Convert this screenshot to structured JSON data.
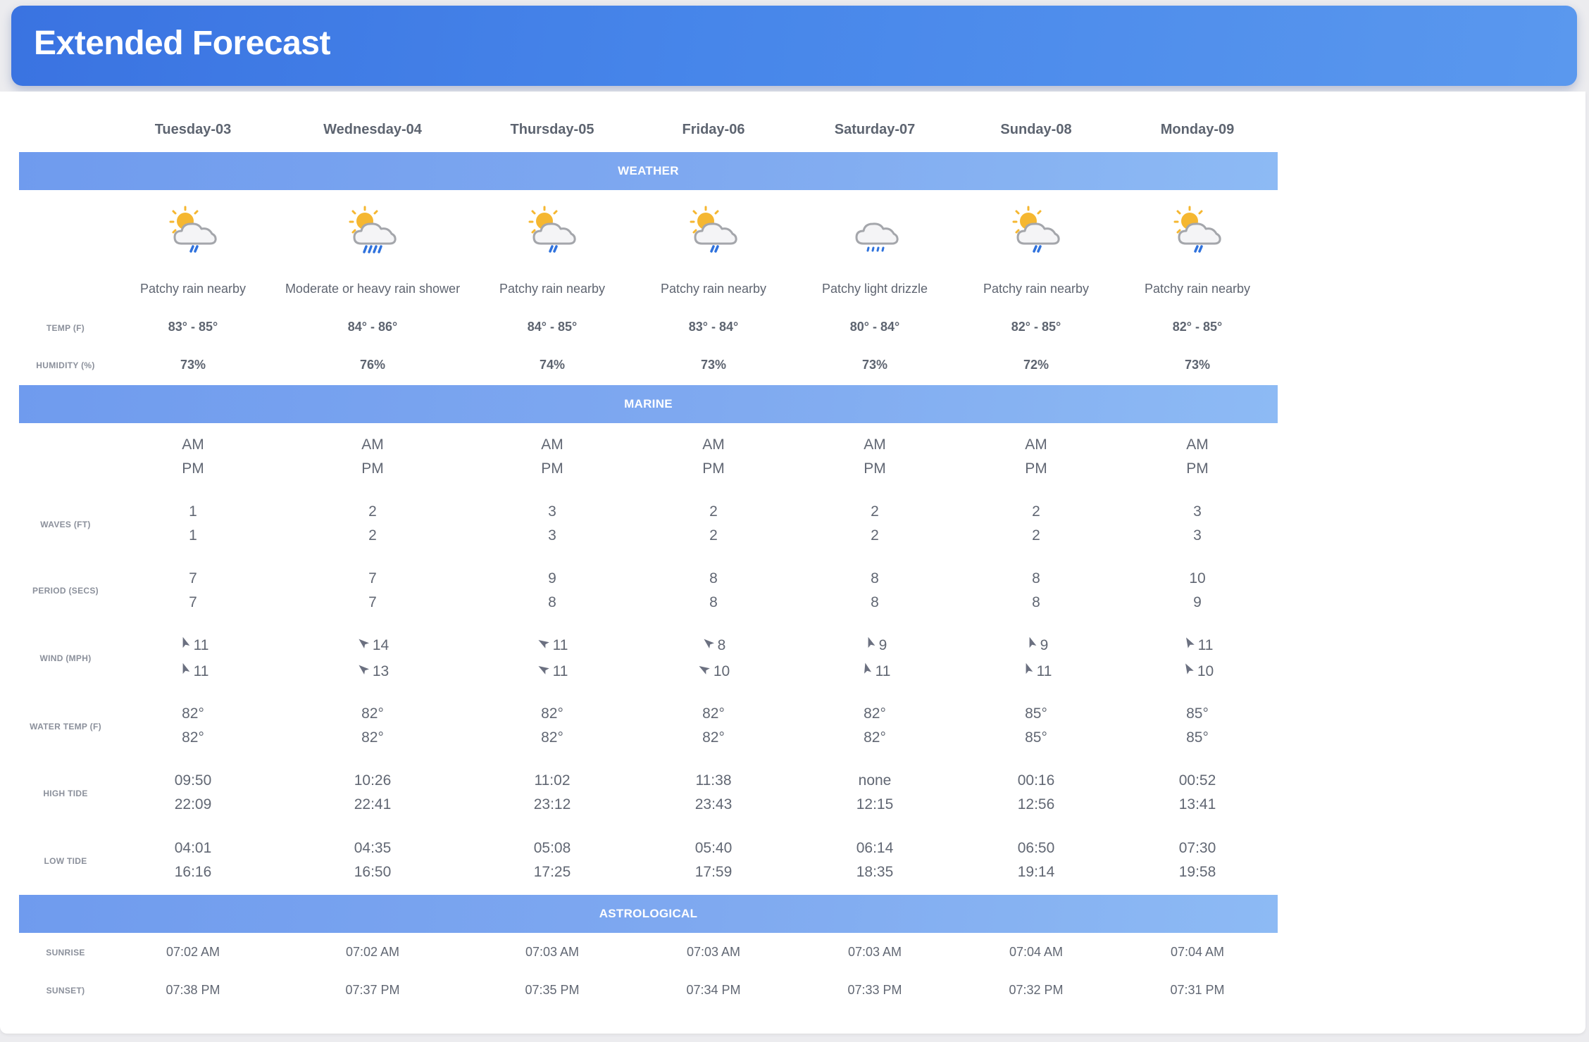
{
  "header": {
    "title": "Extended Forecast"
  },
  "days": [
    {
      "name": "Tuesday-03",
      "condition": "Patchy rain nearby",
      "icon": "patchy-rain-icon",
      "temp": "83° - 85°",
      "humidity": "73%",
      "am_label": "AM",
      "pm_label": "PM",
      "waves": {
        "am": "1",
        "pm": "1"
      },
      "period": {
        "am": "7",
        "pm": "7"
      },
      "wind": {
        "am": "11",
        "pm": "11",
        "am_dir": 160,
        "pm_dir": 160
      },
      "water_temp": {
        "am": "82°",
        "pm": "82°"
      },
      "high_tide": {
        "am": "09:50",
        "pm": "22:09"
      },
      "low_tide": {
        "am": "04:01",
        "pm": "16:16"
      },
      "sunrise": "07:02 AM",
      "sunset": "07:38 PM"
    },
    {
      "name": "Wednesday-04",
      "condition": "Moderate or heavy rain shower",
      "icon": "heavy-rain-shower-icon",
      "temp": "84° - 86°",
      "humidity": "76%",
      "am_label": "AM",
      "pm_label": "PM",
      "waves": {
        "am": "2",
        "pm": "2"
      },
      "period": {
        "am": "7",
        "pm": "7"
      },
      "wind": {
        "am": "14",
        "pm": "13",
        "am_dir": 130,
        "pm_dir": 130
      },
      "water_temp": {
        "am": "82°",
        "pm": "82°"
      },
      "high_tide": {
        "am": "10:26",
        "pm": "22:41"
      },
      "low_tide": {
        "am": "04:35",
        "pm": "16:50"
      },
      "sunrise": "07:02 AM",
      "sunset": "07:37 PM"
    },
    {
      "name": "Thursday-05",
      "condition": "Patchy rain nearby",
      "icon": "patchy-rain-icon",
      "temp": "84° - 85°",
      "humidity": "74%",
      "am_label": "AM",
      "pm_label": "PM",
      "waves": {
        "am": "3",
        "pm": "3"
      },
      "period": {
        "am": "9",
        "pm": "8"
      },
      "wind": {
        "am": "11",
        "pm": "11",
        "am_dir": 120,
        "pm_dir": 120
      },
      "water_temp": {
        "am": "82°",
        "pm": "82°"
      },
      "high_tide": {
        "am": "11:02",
        "pm": "23:12"
      },
      "low_tide": {
        "am": "05:08",
        "pm": "17:25"
      },
      "sunrise": "07:03 AM",
      "sunset": "07:35 PM"
    },
    {
      "name": "Friday-06",
      "condition": "Patchy rain nearby",
      "icon": "patchy-rain-icon",
      "temp": "83° - 84°",
      "humidity": "73%",
      "am_label": "AM",
      "pm_label": "PM",
      "waves": {
        "am": "2",
        "pm": "2"
      },
      "period": {
        "am": "8",
        "pm": "8"
      },
      "wind": {
        "am": "8",
        "pm": "10",
        "am_dir": 130,
        "pm_dir": 120
      },
      "water_temp": {
        "am": "82°",
        "pm": "82°"
      },
      "high_tide": {
        "am": "11:38",
        "pm": "23:43"
      },
      "low_tide": {
        "am": "05:40",
        "pm": "17:59"
      },
      "sunrise": "07:03 AM",
      "sunset": "07:34 PM"
    },
    {
      "name": "Saturday-07",
      "condition": "Patchy light drizzle",
      "icon": "light-drizzle-icon",
      "temp": "80° - 84°",
      "humidity": "73%",
      "am_label": "AM",
      "pm_label": "PM",
      "waves": {
        "am": "2",
        "pm": "2"
      },
      "period": {
        "am": "8",
        "pm": "8"
      },
      "wind": {
        "am": "9",
        "pm": "11",
        "am_dir": 160,
        "pm_dir": 165
      },
      "water_temp": {
        "am": "82°",
        "pm": "82°"
      },
      "high_tide": {
        "am": "none",
        "pm": "12:15"
      },
      "low_tide": {
        "am": "06:14",
        "pm": "18:35"
      },
      "sunrise": "07:03 AM",
      "sunset": "07:33 PM"
    },
    {
      "name": "Sunday-08",
      "condition": "Patchy rain nearby",
      "icon": "patchy-rain-icon",
      "temp": "82° - 85°",
      "humidity": "72%",
      "am_label": "AM",
      "pm_label": "PM",
      "waves": {
        "am": "2",
        "pm": "2"
      },
      "period": {
        "am": "8",
        "pm": "8"
      },
      "wind": {
        "am": "9",
        "pm": "11",
        "am_dir": 160,
        "pm_dir": 160
      },
      "water_temp": {
        "am": "85°",
        "pm": "85°"
      },
      "high_tide": {
        "am": "00:16",
        "pm": "12:56"
      },
      "low_tide": {
        "am": "06:50",
        "pm": "19:14"
      },
      "sunrise": "07:04 AM",
      "sunset": "07:32 PM"
    },
    {
      "name": "Monday-09",
      "condition": "Patchy rain nearby",
      "icon": "patchy-rain-icon",
      "temp": "82° - 85°",
      "humidity": "73%",
      "am_label": "AM",
      "pm_label": "PM",
      "waves": {
        "am": "3",
        "pm": "3"
      },
      "period": {
        "am": "10",
        "pm": "9"
      },
      "wind": {
        "am": "11",
        "pm": "10",
        "am_dir": 150,
        "pm_dir": 150
      },
      "water_temp": {
        "am": "85°",
        "pm": "85°"
      },
      "high_tide": {
        "am": "00:52",
        "pm": "13:41"
      },
      "low_tide": {
        "am": "07:30",
        "pm": "19:58"
      },
      "sunrise": "07:04 AM",
      "sunset": "07:31 PM"
    }
  ],
  "sections": {
    "weather": "WEATHER",
    "marine": "MARINE",
    "astro": "ASTROLOGICAL"
  },
  "labels": {
    "temp": "TEMP (F)",
    "humidity": "HUMIDITY (%)",
    "waves": "WAVES (FT)",
    "period": "PERIOD (SECS)",
    "wind": "WIND (MPH)",
    "water_temp": "WATER TEMP (F)",
    "high_tide": "HIGH TIDE",
    "low_tide": "LOW TIDE",
    "sunrise": "SUNRISE",
    "sunset": "SUNSET)"
  },
  "colors": {
    "header": "#3a73e1",
    "band": "#7fa9f0",
    "arrow": "#6b7080"
  }
}
